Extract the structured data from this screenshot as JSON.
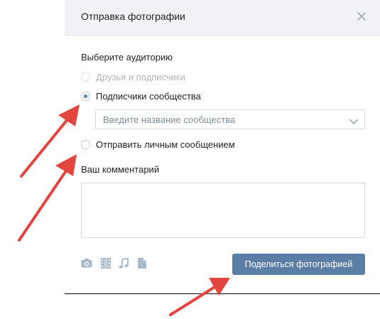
{
  "modal": {
    "title": "Отправка фотографии",
    "close_icon": "close-icon"
  },
  "audience": {
    "label": "Выберите аудиторию",
    "options": [
      {
        "label": "Друзья и подписчики",
        "state": "disabled"
      },
      {
        "label": "Подписчики сообщества",
        "state": "checked"
      },
      {
        "label": "Отправить личным сообщением",
        "state": "unchecked"
      }
    ],
    "community_select": {
      "placeholder": "Введите название сообщества",
      "icon": "chevron-down-icon"
    }
  },
  "comment": {
    "label": "Ваш комментарий",
    "value": ""
  },
  "attachments": [
    "camera-icon",
    "video-icon",
    "music-icon",
    "document-icon"
  ],
  "share_button": {
    "label": "Поделиться фотографией"
  },
  "colors": {
    "header_bg": "#f0f2f5",
    "button_bg": "#5b7ea6",
    "radio_accent": "#5181b8",
    "icon_color": "#aab8c7",
    "annotation_arrow": "#e2463e"
  }
}
